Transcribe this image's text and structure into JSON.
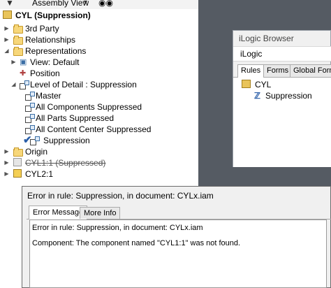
{
  "toolbar": {
    "filter_icon": "funnel-icon",
    "view_label": "Assembly View",
    "search_icon": "binoculars-icon"
  },
  "tree": {
    "root": "CYL (Suppression)",
    "third_party": "3rd Party",
    "relationships": "Relationships",
    "representations": "Representations",
    "view": "View: Default",
    "position": "Position",
    "lod": "Level of Detail : Suppression",
    "lod_items": [
      "Master",
      "All Components Suppressed",
      "All Parts Suppressed",
      "All Content Center Suppressed",
      "Suppression"
    ],
    "origin": "Origin",
    "cyl1": "CYL1:1 (Suppressed)",
    "cyl2": "CYL2:1"
  },
  "ilogic": {
    "window_title": "iLogic Browser",
    "header": "iLogic",
    "tabs": [
      "Rules",
      "Forms",
      "Global Forms"
    ],
    "active_tab": "Rules",
    "rules": {
      "group": "CYL",
      "rule": "Suppression"
    }
  },
  "error_dialog": {
    "title": "Error in rule: Suppression, in document: CYLx.iam",
    "tabs": [
      "Error Message",
      "More Info"
    ],
    "active_tab": "Error Message",
    "message_line1": "Error in rule: Suppression, in document: CYLx.iam",
    "message_line2": "Component: The component named \"CYL1:1\" was not found."
  },
  "colors": {
    "dark_background": "#555b63",
    "folder": "#f7d77a",
    "checkmark": "#2a5ea8",
    "strike_icon": "#c8c8c8"
  }
}
